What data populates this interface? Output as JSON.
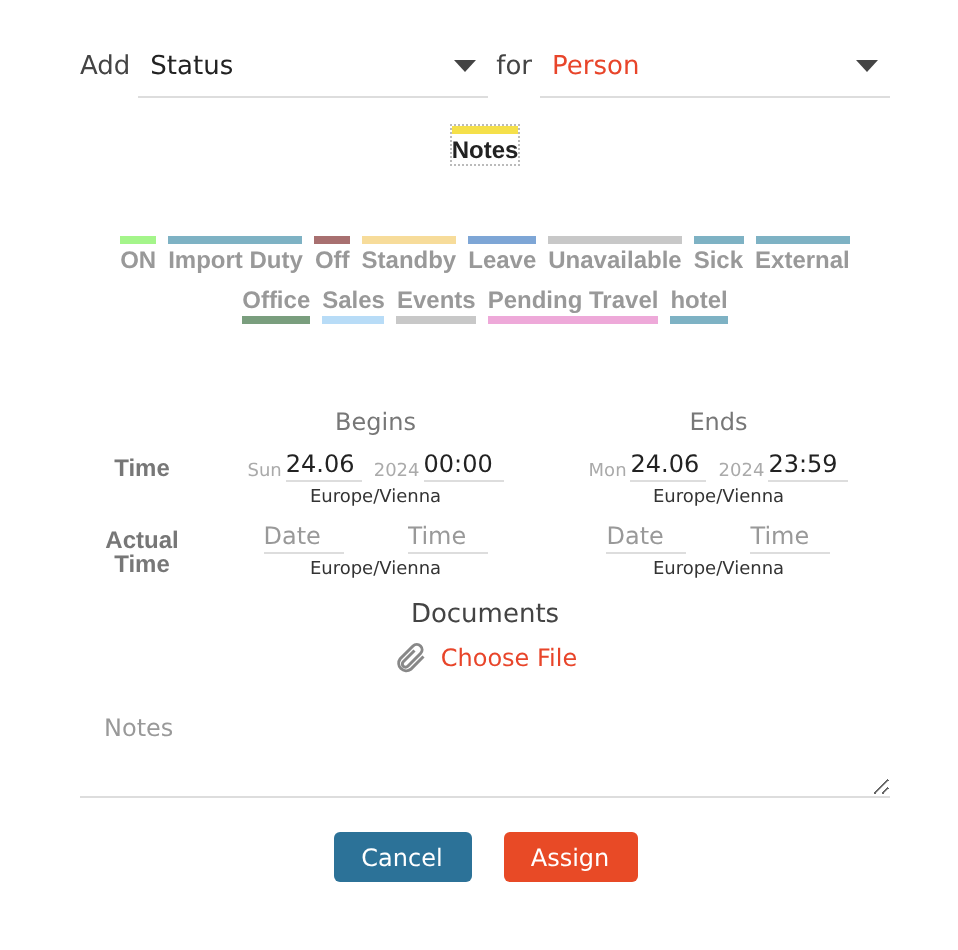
{
  "header": {
    "add_label": "Add",
    "type_select": {
      "value": "Status"
    },
    "for_label": "for",
    "person_select": {
      "value": "Person"
    }
  },
  "status_rows": [
    [
      {
        "label": "Notes",
        "color": "#f5e04a",
        "selected": true,
        "kind": "bar-above"
      }
    ],
    [
      {
        "label": "ON",
        "color": "#a4f58a",
        "selected": false,
        "kind": "bar-above"
      },
      {
        "label": "Import Duty",
        "color": "#7eb2c4",
        "selected": false,
        "kind": "bar-above"
      },
      {
        "label": "Off",
        "color": "#a87070",
        "selected": false,
        "kind": "bar-above"
      },
      {
        "label": "Standby",
        "color": "#f7dc9a",
        "selected": false,
        "kind": "bar-above"
      },
      {
        "label": "Leave",
        "color": "#7ea6d6",
        "selected": false,
        "kind": "bar-above"
      },
      {
        "label": "Unavailable",
        "color": "#c8c8c8",
        "selected": false,
        "kind": "bar-above"
      },
      {
        "label": "Sick",
        "color": "#7eb2c4",
        "selected": false,
        "kind": "bar-above"
      },
      {
        "label": "External",
        "color": "#7eb2c4",
        "selected": false,
        "kind": "bar-above"
      }
    ],
    [
      {
        "label": "Office",
        "color": "#7a9e7e",
        "selected": false,
        "kind": "bar-below"
      },
      {
        "label": "Sales",
        "color": "#b8dcf7",
        "selected": false,
        "kind": "bar-below"
      },
      {
        "label": "Events",
        "color": "#c8c8c8",
        "selected": false,
        "kind": "bar-below"
      },
      {
        "label": "Pending Travel",
        "color": "#eea9d9",
        "selected": false,
        "kind": "bar-below"
      },
      {
        "label": "hotel",
        "color": "#7eb2c4",
        "selected": false,
        "kind": "bar-below"
      }
    ]
  ],
  "time": {
    "begins_heading": "Begins",
    "ends_heading": "Ends",
    "rows": [
      {
        "label": "Time",
        "begins": {
          "weekday": "Sun",
          "date": "24.06",
          "year": "2024",
          "time": "00:00",
          "zone": "Europe/Vienna"
        },
        "ends": {
          "weekday": "Mon",
          "date": "24.06",
          "year": "2024",
          "time": "23:59",
          "zone": "Europe/Vienna"
        }
      },
      {
        "label": "Actual Time",
        "begins": {
          "date_placeholder": "Date",
          "time_placeholder": "Time",
          "zone": "Europe/Vienna"
        },
        "ends": {
          "date_placeholder": "Date",
          "time_placeholder": "Time",
          "zone": "Europe/Vienna"
        }
      }
    ]
  },
  "documents": {
    "heading": "Documents",
    "choose_file": "Choose File"
  },
  "notes": {
    "placeholder": "Notes"
  },
  "buttons": {
    "cancel": "Cancel",
    "assign": "Assign"
  }
}
